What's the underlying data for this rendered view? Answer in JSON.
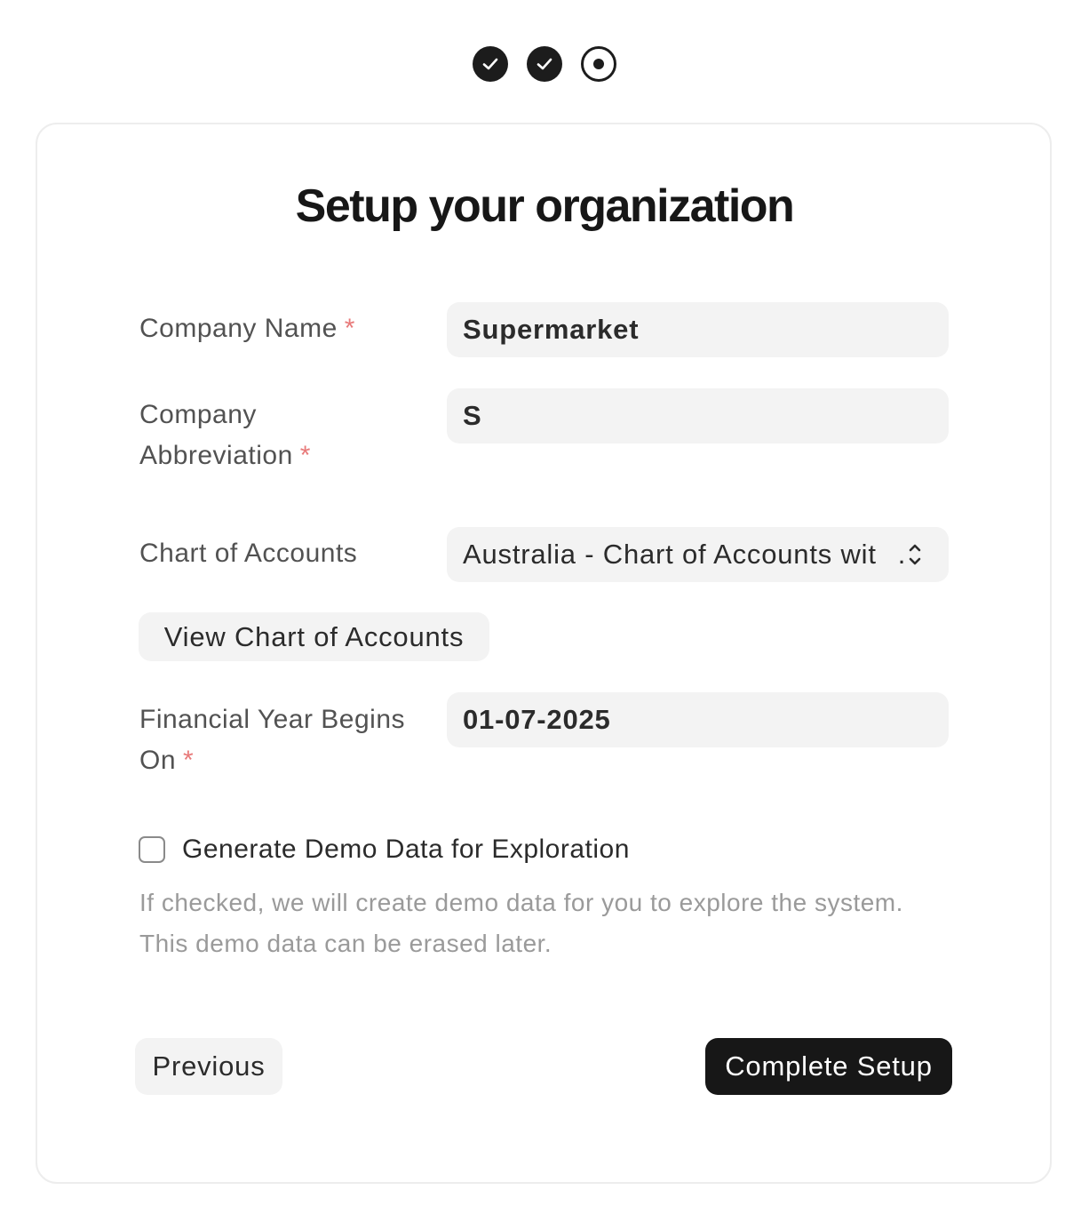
{
  "steps": [
    {
      "state": "completed",
      "icon": "check-icon"
    },
    {
      "state": "completed",
      "icon": "check-icon"
    },
    {
      "state": "current",
      "icon": "dot-icon"
    }
  ],
  "title": "Setup your organization",
  "required_marker": "*",
  "form": {
    "company_name": {
      "label": "Company Name",
      "value": "Supermarket"
    },
    "company_abbreviation": {
      "label_line1": "Company",
      "label_line2": "Abbreviation",
      "value": "S"
    },
    "chart_of_accounts": {
      "label": "Chart of Accounts",
      "value": "Australia - Chart of Accounts wit",
      "value_suffix": "."
    },
    "view_chart_button": "View Chart of Accounts",
    "financial_year": {
      "label_line1": "Financial Year Begins",
      "label_line2": "On",
      "value": "01-07-2025"
    },
    "demo_data": {
      "label": "Generate Demo Data for Exploration",
      "checked": false,
      "help_line1": "If checked, we will create demo data for you to explore the system.",
      "help_line2": "This demo data can be erased later."
    }
  },
  "buttons": {
    "previous": "Previous",
    "complete": "Complete Setup"
  },
  "colors": {
    "primary": "#171717",
    "field_bg": "#f3f3f3",
    "required": "#e87a7a",
    "help_text": "#9a9a9a",
    "card_border": "#ededed"
  }
}
